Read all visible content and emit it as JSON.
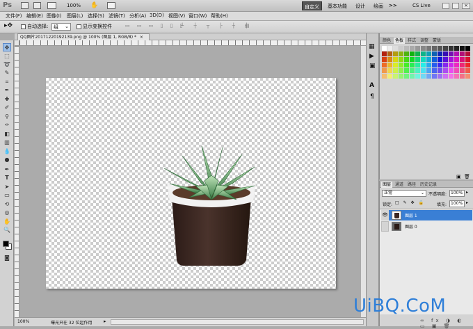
{
  "app": {
    "logo": "Ps",
    "zoom": "100%",
    "workspace_active": "自定义",
    "workspaces": [
      "基本功能",
      "设计",
      "绘画"
    ],
    "more": ">>",
    "cs_live": "CS Live"
  },
  "menu": [
    "文件(F)",
    "编辑(E)",
    "图像(I)",
    "图层(L)",
    "选择(S)",
    "滤镜(T)",
    "分析(A)",
    "3D(D)",
    "视图(V)",
    "窗口(W)",
    "帮助(H)"
  ],
  "options": {
    "auto_select": "自动选择:",
    "auto_select_value": "组",
    "show_transform": "显示变换控件"
  },
  "document": {
    "tab_title": "QQ图片20171220192139.png @ 100% (图层 1, RGB/8) *",
    "tab_close": "×"
  },
  "status": {
    "zoom": "100%",
    "info": "曝光只在 32 位起作用"
  },
  "swatches_panel": {
    "tabs": [
      "颜色",
      "色板",
      "样式",
      "调整",
      "蒙版"
    ],
    "active": "色板"
  },
  "layers_panel": {
    "tabs": [
      "图层",
      "通道",
      "路径",
      "历史记录"
    ],
    "blend_mode": "正常",
    "opacity_label": "不透明度:",
    "opacity": "100%",
    "lock_label": "锁定:",
    "fill_label": "填充:",
    "fill": "100%",
    "layers": [
      {
        "name": "图层 1",
        "selected": true,
        "visible": true
      },
      {
        "name": "图层 0",
        "selected": false,
        "visible": false
      }
    ]
  },
  "watermark": "UiBQ.CoM",
  "colors": {
    "accent": "#3a7fd5",
    "selected_layer": "#3a7fd5",
    "pot": "#3b2722",
    "leaf": "#6ea96e"
  }
}
